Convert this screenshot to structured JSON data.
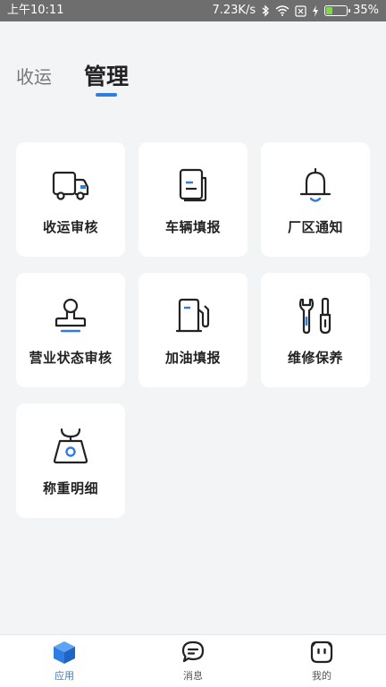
{
  "status_bar": {
    "time": "上午10:11",
    "network_speed": "7.23K/s",
    "battery_percent": "35%",
    "battery_level": 0.35
  },
  "tabs": [
    {
      "label": "收运",
      "active": false
    },
    {
      "label": "管理",
      "active": true
    }
  ],
  "grid": {
    "items": [
      {
        "label": "收运审核",
        "icon": "truck-icon"
      },
      {
        "label": "车辆填报",
        "icon": "document-icon"
      },
      {
        "label": "厂区通知",
        "icon": "bell-icon"
      },
      {
        "label": "营业状态审核",
        "icon": "stamp-icon"
      },
      {
        "label": "加油填报",
        "icon": "fuel-pump-icon"
      },
      {
        "label": "维修保养",
        "icon": "wrench-screwdriver-icon"
      },
      {
        "label": "称重明细",
        "icon": "scale-icon"
      }
    ]
  },
  "bottom_nav": {
    "items": [
      {
        "label": "应用",
        "icon": "cube-icon",
        "active": true
      },
      {
        "label": "消息",
        "icon": "message-icon",
        "active": false
      },
      {
        "label": "我的",
        "icon": "face-icon",
        "active": false
      }
    ]
  },
  "colors": {
    "accent": "#2f7de1",
    "icon_stroke": "#222222",
    "status_bar": "#6e6e6e",
    "background": "#f3f4f6",
    "battery_fill": "#7ddc3f"
  }
}
